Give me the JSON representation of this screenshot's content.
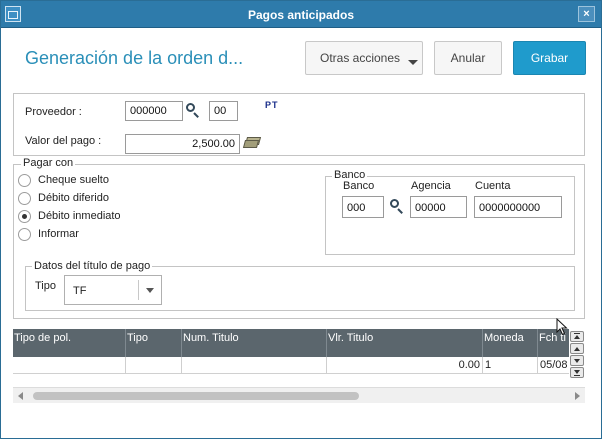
{
  "window": {
    "title": "Pagos anticipados",
    "close_glyph": "×"
  },
  "header": {
    "page_title": "Generación de la orden d...",
    "buttons": {
      "otras_acciones": "Otras acciones",
      "anular": "Anular",
      "grabar": "Grabar"
    }
  },
  "proveedor": {
    "label": "Proveedor :",
    "code": "000000",
    "branch": "00",
    "logo_text": "PT",
    "valor_label": "Valor del pago :",
    "valor": "2,500.00"
  },
  "pagar_con": {
    "legend": "Pagar con",
    "options": [
      {
        "label": "Cheque suelto",
        "checked": false
      },
      {
        "label": "Débito diferido",
        "checked": false
      },
      {
        "label": "Débito inmediato",
        "checked": true
      },
      {
        "label": "Informar",
        "checked": false
      }
    ],
    "banco": {
      "legend": "Banco",
      "banco_label": "Banco",
      "banco_value": "000",
      "agencia_label": "Agencia",
      "agencia_value": "00000",
      "cuenta_label": "Cuenta",
      "cuenta_value": "0000000000"
    },
    "titulo": {
      "legend": "Datos del título de pago",
      "tipo_label": "Tipo",
      "tipo_value": "TF"
    }
  },
  "grid": {
    "columns": [
      "Tipo de pol.",
      "Tipo",
      "Num. Titulo",
      "Vlr. Titulo",
      "Moneda",
      "Fch ti"
    ],
    "rows": [
      [
        "",
        "",
        "",
        "0.00",
        "1",
        "05/08"
      ]
    ]
  },
  "icons": {
    "app": "window-icon",
    "search": "search-icon",
    "money": "money-icon",
    "cursor": "mouse-cursor-icon"
  },
  "colors": {
    "titlebar": "#2e7bab",
    "accent": "#1f9bcc",
    "page_title": "#2a8fb8",
    "grid_header": "#5b666d"
  }
}
